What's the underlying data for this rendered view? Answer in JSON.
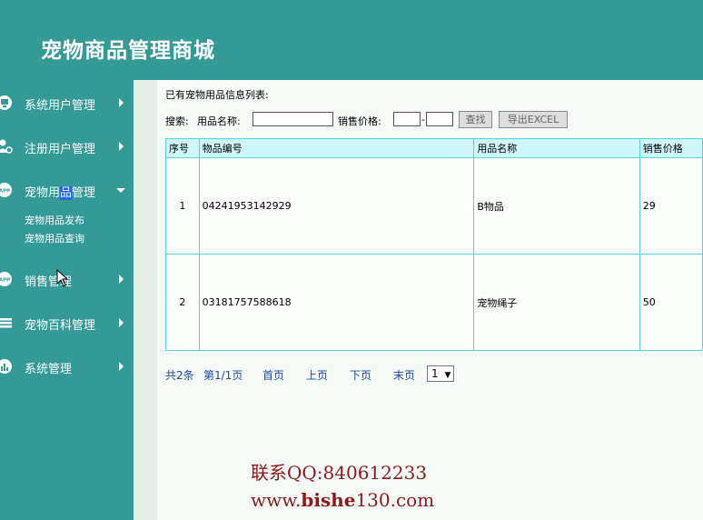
{
  "app": {
    "title": "宠物商品管理商城"
  },
  "sidebar": {
    "items": [
      {
        "label": "系统用户管理",
        "icon": "monitor-icon"
      },
      {
        "label": "注册用户管理",
        "icon": "user-gear-icon"
      },
      {
        "label_pre": "宠物用",
        "label_hl": "品",
        "label_post": "管理",
        "icon": "app-icon",
        "expanded": true,
        "sub_items": [
          "宠物用品发布",
          "宠物用品查询"
        ]
      },
      {
        "label": "销售管理",
        "icon": "app-icon"
      },
      {
        "label": "宠物百科管理",
        "icon": "list-icon"
      },
      {
        "label": "系统管理",
        "icon": "bar-chart-icon"
      }
    ]
  },
  "main": {
    "list_title": "已有宠物用品信息列表:",
    "search": {
      "label": "搜索:",
      "name_label": "用品名称:",
      "name_value": "",
      "price_label": "销售价格:",
      "price_min": "",
      "price_max": "",
      "range_sep": "-",
      "find_button": "查找",
      "export_button": "导出EXCEL"
    },
    "table": {
      "headers": [
        "序号",
        "物品编号",
        "用品名称",
        "销售价格"
      ],
      "rows": [
        [
          "1",
          "04241953142929",
          "B物品",
          "29"
        ],
        [
          "2",
          "03181757588618",
          "宠物绳子",
          "50"
        ]
      ]
    },
    "pager": {
      "total": "共2条",
      "page_info": "第1/1页",
      "first": "首页",
      "prev": "上页",
      "next": "下页",
      "last": "末页",
      "select_value": "1"
    }
  },
  "watermark": {
    "line1": "联系QQ:840612233",
    "line2_prefix": "www.",
    "line2_bold": "bishe",
    "line2_suffix": "130.com"
  },
  "colors": {
    "teal": "#339a96",
    "table_border": "#55d4e0",
    "link": "#1a49a8",
    "watermark": "#8b1a1a"
  }
}
